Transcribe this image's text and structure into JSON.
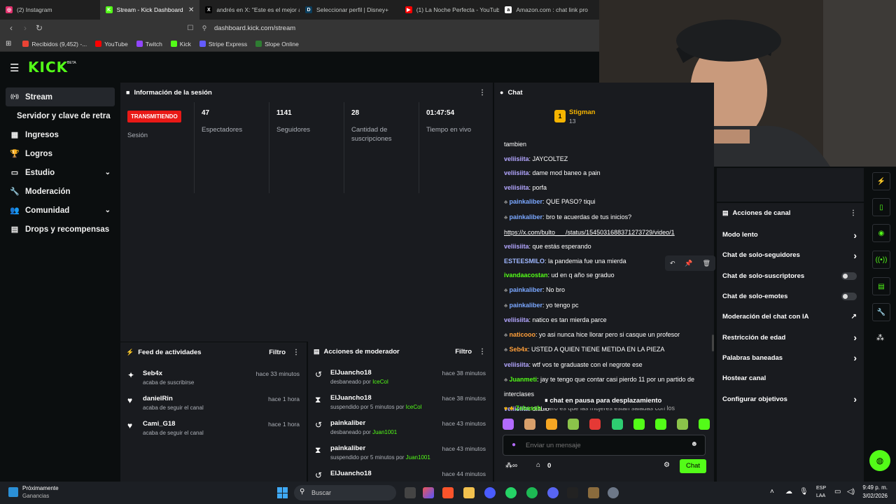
{
  "browser": {
    "tabs": [
      {
        "title": "(2) Instagram",
        "color": "#e1306c",
        "glyph": "◎"
      },
      {
        "title": "Stream - Kick Dashboard",
        "color": "#53fc18",
        "glyph": "K",
        "active": true
      },
      {
        "title": "andrés en X: \"Este es el mejor a",
        "color": "#000000",
        "glyph": "X"
      },
      {
        "title": "Seleccionar perfil | Disney+",
        "color": "#0b3d5c",
        "glyph": "D"
      },
      {
        "title": "(1) La Noche Perfecta - YouTub",
        "color": "#ff0000",
        "glyph": "▶"
      },
      {
        "title": "Amazon.com : chat link pro",
        "color": "#ffffff",
        "glyph": "a"
      }
    ],
    "url": "dashboard.kick.com/stream",
    "bookmarks": [
      {
        "label": "Recibidos (9,452) -...",
        "color": "#ea4335"
      },
      {
        "label": "YouTube",
        "color": "#ff0000"
      },
      {
        "label": "Twitch",
        "color": "#9146ff"
      },
      {
        "label": "Kick",
        "color": "#53fc18"
      },
      {
        "label": "Stripe Express",
        "color": "#635bff"
      },
      {
        "label": "Slope Online",
        "color": "#2e7d32"
      }
    ]
  },
  "kick": {
    "logo": "KICK",
    "logo_badge": "BETA",
    "sidebar": [
      {
        "label": "Stream",
        "icon": "stream-icon",
        "glyph": "((•))",
        "active": true
      },
      {
        "label": "Servidor y clave de retransmisión",
        "icon": "",
        "glyph": ""
      },
      {
        "label": "Ingresos",
        "icon": "money-icon",
        "glyph": "▦"
      },
      {
        "label": "Logros",
        "icon": "trophy-icon",
        "glyph": "🏆"
      },
      {
        "label": "Estudio",
        "icon": "studio-icon",
        "glyph": "▭",
        "chev": true
      },
      {
        "label": "Moderación",
        "icon": "wrench-icon",
        "glyph": "🔧"
      },
      {
        "label": "Comunidad",
        "icon": "community-icon",
        "glyph": "👥",
        "chev": true
      },
      {
        "label": "Drops y recompensas",
        "icon": "gift-icon",
        "glyph": "▤"
      }
    ],
    "session": {
      "title": "Información de la sesión",
      "status_badge": "TRANSMITIENDO",
      "session_label": "Sesión",
      "stats": [
        {
          "value": "47",
          "label": "Espectadores"
        },
        {
          "value": "1141",
          "label": "Seguidores"
        },
        {
          "value": "28",
          "label": "Cantidad de suscripciones"
        },
        {
          "value": "01:47:54",
          "label": "Tiempo en vivo"
        }
      ]
    },
    "activity": {
      "title": "Feed de actividades",
      "filter": "Filtro",
      "items": [
        {
          "name": "Seb4x",
          "sub": "acaba de suscribirse",
          "time": "hace 33 minutos",
          "icon": "sparkle-icon",
          "glyph": "✦"
        },
        {
          "name": "danielRin",
          "sub": "acaba de seguir el canal",
          "time": "hace 1 hora",
          "icon": "heart-icon",
          "glyph": "♥"
        },
        {
          "name": "Cami_G18",
          "sub": "acaba de seguir el canal",
          "time": "hace 1 hora",
          "icon": "heart-icon",
          "glyph": "♥"
        }
      ]
    },
    "modactions": {
      "title": "Acciones de moderador",
      "filter": "Filtro",
      "items": [
        {
          "name": "ElJuancho18",
          "action": "desbaneado por",
          "mod": "IceCol",
          "time": "hace 38 minutos",
          "icon": "undo-icon",
          "glyph": "↺"
        },
        {
          "name": "ElJuancho18",
          "action": "suspendido por 5 minutos por",
          "mod": "IceCol",
          "time": "hace 38 minutos",
          "icon": "hourglass-icon",
          "glyph": "⧗"
        },
        {
          "name": "painkaliber",
          "action": "desbaneado por",
          "mod": "Juan1001",
          "time": "hace 43 minutos",
          "icon": "undo-icon",
          "glyph": "↺"
        },
        {
          "name": "painkaliber",
          "action": "suspendido por 5 minutos por",
          "mod": "Juan1001",
          "time": "hace 43 minutos",
          "icon": "hourglass-icon",
          "glyph": "⧗"
        },
        {
          "name": "ElJuancho18",
          "action": "",
          "mod": "",
          "time": "hace 44 minutos",
          "icon": "undo-icon",
          "glyph": "↺"
        }
      ]
    },
    "chat": {
      "title": "Chat",
      "pinned_user": "Stigman",
      "pinned_count": "13",
      "messages": [
        {
          "user": "",
          "text": "tambien",
          "color": "#ffffff"
        },
        {
          "user": "veliisiita",
          "text": ": JAYCOLTEZ",
          "color": "#b3a6ff"
        },
        {
          "user": "veliisiita",
          "text": ": dame mod baneo a pain",
          "color": "#b3a6ff"
        },
        {
          "user": "veliisiita",
          "text": ": porfa",
          "color": "#b3a6ff"
        },
        {
          "user": "painkaliber",
          "text": ": QUE PASO? tiqui",
          "color": "#7aa7ff",
          "badge": true
        },
        {
          "user": "painkaliber",
          "text": ": bro te acuerdas de tus inicios?",
          "color": "#7aa7ff",
          "badge": true
        },
        {
          "user": "",
          "text": "https://x.com/bulto___/status/1545031688371273729/video/1",
          "color": "#ffffff",
          "link": true
        },
        {
          "user": "veliisiita",
          "text": ": que estás esperando",
          "color": "#b3a6ff"
        },
        {
          "user": "ESTEESMILO",
          "text": ": la pandemia fue una mierda",
          "color": "#9fb7ff"
        },
        {
          "user": "ivandaacostan",
          "text": ": ud en q año se graduo",
          "color": "#53fc18"
        },
        {
          "user": "painkaliber",
          "text": ": No bro",
          "color": "#7aa7ff",
          "badge": true
        },
        {
          "user": "painkaliber",
          "text": ": yo tengo pc",
          "color": "#7aa7ff",
          "badge": true
        },
        {
          "user": "veliisiita",
          "text": ": natico es tan mierda parce",
          "color": "#b3a6ff"
        },
        {
          "user": "naticooo",
          "text": ": yo asi nunca hice llorar pero si casque un profesor",
          "color": "#ff9f3a",
          "badge": true
        },
        {
          "user": "Seb4x",
          "text": ": USTED A QUIEN TIENE METIDA EN LA PIEZA",
          "color": "#ff9f3a",
          "badge": true
        },
        {
          "user": "veliisiita",
          "text": ": wtf vos te graduaste con el negrote ese",
          "color": "#b3a6ff"
        },
        {
          "user": "Juanmeti",
          "text": ": jay te tengo que contar casi pierdo 11 por un partido de",
          "color": "#53fc18",
          "badge": true
        },
        {
          "user": "",
          "text": "interclases",
          "color": "#ffffff"
        },
        {
          "user": "veliisiita",
          "text": ": diablo",
          "color": "#b3a6ff"
        }
      ],
      "last_line_user": "Zebassh",
      "last_line_text": ": Pero es que las mujeres están saladas con los",
      "paused": "chat en pausa para desplazamiento",
      "input_placeholder": "Enviar un mensaje",
      "points": "0",
      "send_label": "Chat"
    },
    "channel_actions": {
      "title": "Acciones de canal",
      "items": [
        {
          "label": "Modo lento",
          "kind": "chevron"
        },
        {
          "label": "Chat de solo-seguidores",
          "kind": "chevron"
        },
        {
          "label": "Chat de solo-suscriptores",
          "kind": "toggle"
        },
        {
          "label": "Chat de solo-emotes",
          "kind": "toggle"
        },
        {
          "label": "Moderación del chat con IA",
          "kind": "external"
        },
        {
          "label": "Restricción de edad",
          "kind": "chevron"
        },
        {
          "label": "Palabras baneadas",
          "kind": "chevron"
        },
        {
          "label": "Hostear canal",
          "kind": "none"
        },
        {
          "label": "Configurar objetivos",
          "kind": "chevron"
        }
      ]
    },
    "accent": "#53fc18"
  },
  "taskbar": {
    "weather_title": "Próximamente",
    "weather_sub": "Ganancias",
    "search": "Buscar",
    "lang": "ESP",
    "lang2": "LAA",
    "time": "9:49 p. m.",
    "date": "3/02/2026"
  }
}
